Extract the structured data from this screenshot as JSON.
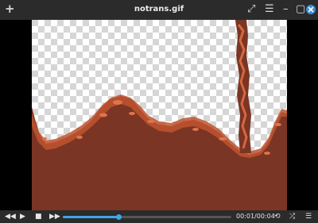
{
  "window": {
    "title": "notrans.gif",
    "new_tab_icon": "plus-icon",
    "expand_icon": "expand-icon",
    "menu_icon": "hamburger-menu-icon",
    "minimize_icon": "minimize-icon",
    "maximize_icon": "maximize-icon",
    "close_icon": "close-icon"
  },
  "player": {
    "time_display": "00:01/00:04",
    "progress": 0.33,
    "accent_color": "#3ea6e6"
  },
  "glyphs": {
    "plus": "+",
    "expand": "⤢",
    "menu": "☰",
    "minimize": "–",
    "maximize": "▢",
    "rewind": "◀◀",
    "play": "▶",
    "stop": "■",
    "forward": "▶▶",
    "loop": "⟲",
    "shuffle": "⤮",
    "list": "☰"
  }
}
